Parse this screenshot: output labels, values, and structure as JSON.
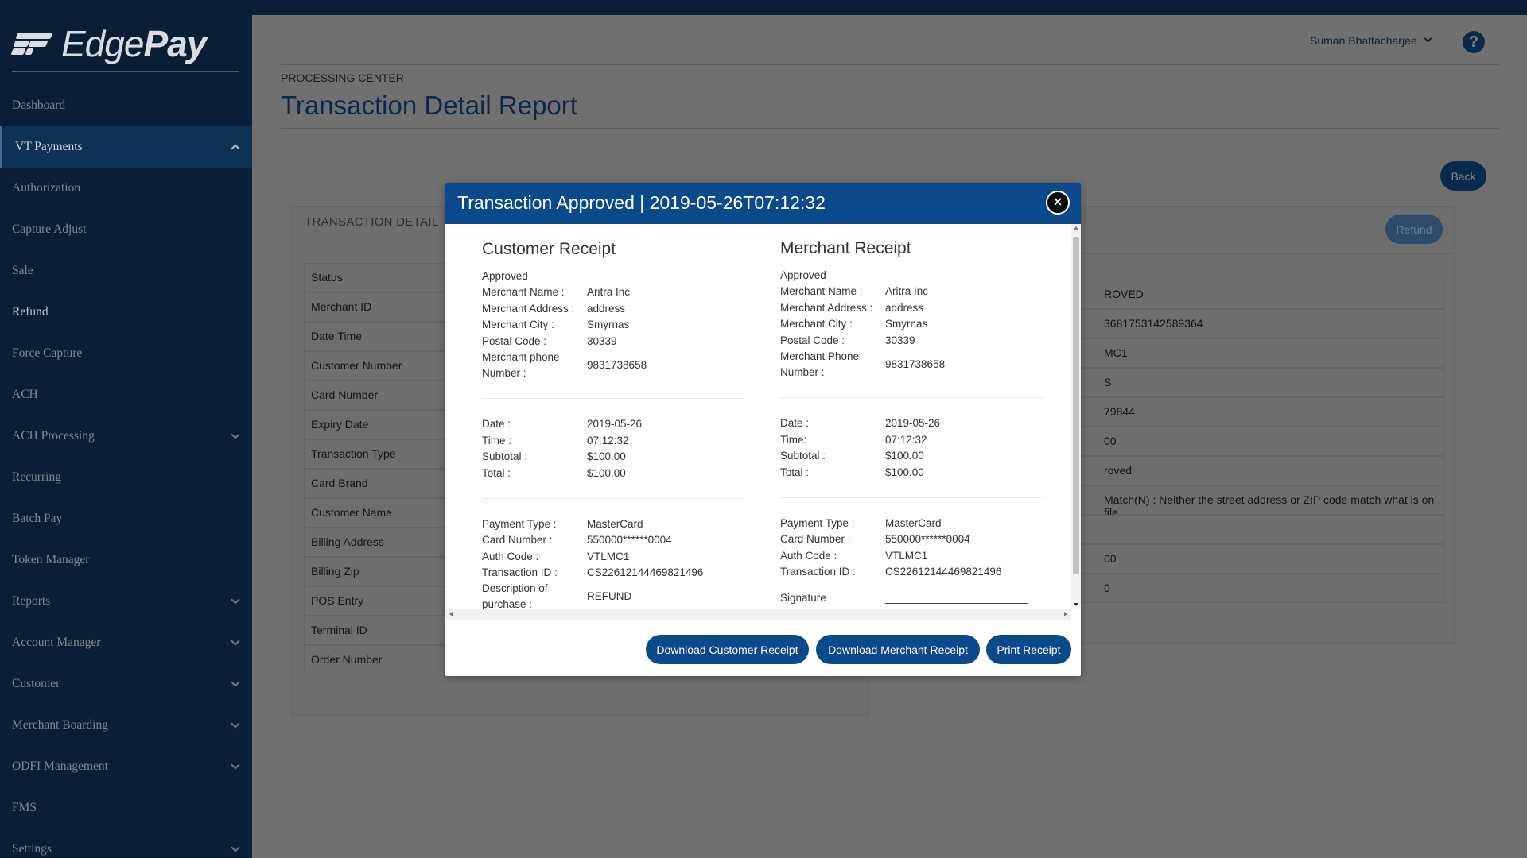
{
  "brand": {
    "name_light": "Edge",
    "name_bold": "Pay"
  },
  "sidebar": {
    "items": [
      {
        "label": "Dashboard"
      },
      {
        "label": "VT Payments"
      },
      {
        "label": "Authorization"
      },
      {
        "label": "Capture Adjust"
      },
      {
        "label": "Sale"
      },
      {
        "label": "Refund"
      },
      {
        "label": "Force Capture"
      },
      {
        "label": "ACH"
      },
      {
        "label": "ACH Processing"
      },
      {
        "label": "Recurring"
      },
      {
        "label": "Batch Pay"
      },
      {
        "label": "Token Manager"
      },
      {
        "label": "Reports"
      },
      {
        "label": "Account Manager"
      },
      {
        "label": "Customer"
      },
      {
        "label": "Merchant Boarding"
      },
      {
        "label": "ODFI Management"
      },
      {
        "label": "FMS"
      },
      {
        "label": "Settings"
      }
    ]
  },
  "header": {
    "user_name": "Suman Bhattacharjee",
    "help": "?"
  },
  "page": {
    "breadcrumb": "PROCESSING CENTER",
    "title": "Transaction Detail Report",
    "back_label": "Back",
    "refund_label": "Refund",
    "left_panel_title": "TRANSACTION DETAIL",
    "detail_labels": [
      "Status",
      "Merchant ID",
      "Date:Time",
      "Customer Number",
      "Card Number",
      "Expiry Date",
      "Transaction Type",
      "Card Brand",
      "Customer Name",
      "Billing Address",
      "Billing Zip",
      "POS Entry",
      "Terminal ID",
      "Order Number"
    ],
    "detail_values": [
      "ROVED",
      "3681753142589364",
      "MC1",
      "S",
      "79844",
      "00",
      "roved",
      "Match(N) : Neither the street address or ZIP code match what is on file.",
      "",
      "00",
      "0"
    ]
  },
  "modal": {
    "title": "Transaction Approved | 2019-05-26T07:12:32",
    "close": "×",
    "customer": {
      "heading": "Customer Receipt",
      "status": "Approved",
      "merchant_name_label": "Merchant Name :",
      "merchant_name": "Aritra Inc",
      "merchant_address_label": "Merchant Address :",
      "merchant_address": "address",
      "merchant_city_label": "Merchant City :",
      "merchant_city": "Smyrnas",
      "postal_code_label": "Postal Code :",
      "postal_code": "30339",
      "phone_label_1": "Merchant phone",
      "phone_label_2": "Number :",
      "phone": "9831738658",
      "date_label": "Date :",
      "date": "2019-05-26",
      "time_label": "Time :",
      "time": "07:12:32",
      "subtotal_label": "Subtotal :",
      "subtotal": "$100.00",
      "total_label": "Total :",
      "total": "$100.00",
      "payment_type_label": "Payment Type :",
      "payment_type": "MasterCard",
      "card_number_label": "Card Number :",
      "card_number": "550000******0004",
      "auth_code_label": "Auth Code :",
      "auth_code": "VTLMC1",
      "transaction_id_label": "Transaction ID :",
      "transaction_id": "CS22612144469821496",
      "description_label_1": "Description of",
      "description_label_2": "purchase :",
      "description": "REFUND"
    },
    "merchant": {
      "heading": "Merchant Receipt",
      "status": "Approved",
      "merchant_name_label": "Merchant Name :",
      "merchant_name": "Aritra Inc",
      "merchant_address_label": "Merchant Address :",
      "merchant_address": "address",
      "merchant_city_label": "Merchant City :",
      "merchant_city": "Smyrnas",
      "postal_code_label": "Postal Code :",
      "postal_code": "30339",
      "phone_label_1": "Merchant Phone",
      "phone_label_2": "Number :",
      "phone": "9831738658",
      "date_label": "Date :",
      "date": "2019-05-26",
      "time_label": "Time:",
      "time": "07:12:32",
      "subtotal_label": "Subtotal :",
      "subtotal": "$100.00",
      "total_label": "Total :",
      "total": "$100.00",
      "payment_type_label": "Payment Type :",
      "payment_type": "MasterCard",
      "card_number_label": "Card Number :",
      "card_number": "550000******0004",
      "auth_code_label": "Auth Code :",
      "auth_code": "VTLMC1",
      "transaction_id_label": "Transaction ID :",
      "transaction_id": "CS22612144469821496",
      "signature_label": "Signature",
      "signature_line": "________________________"
    },
    "buttons": {
      "download_customer": "Download Customer Receipt",
      "download_merchant": "Download Merchant Receipt",
      "print": "Print Receipt"
    }
  },
  "colors": {
    "modal_header": "#0a4a8a",
    "sidebar_bg": "#0a1f35",
    "button_primary": "#0a4a8a"
  }
}
